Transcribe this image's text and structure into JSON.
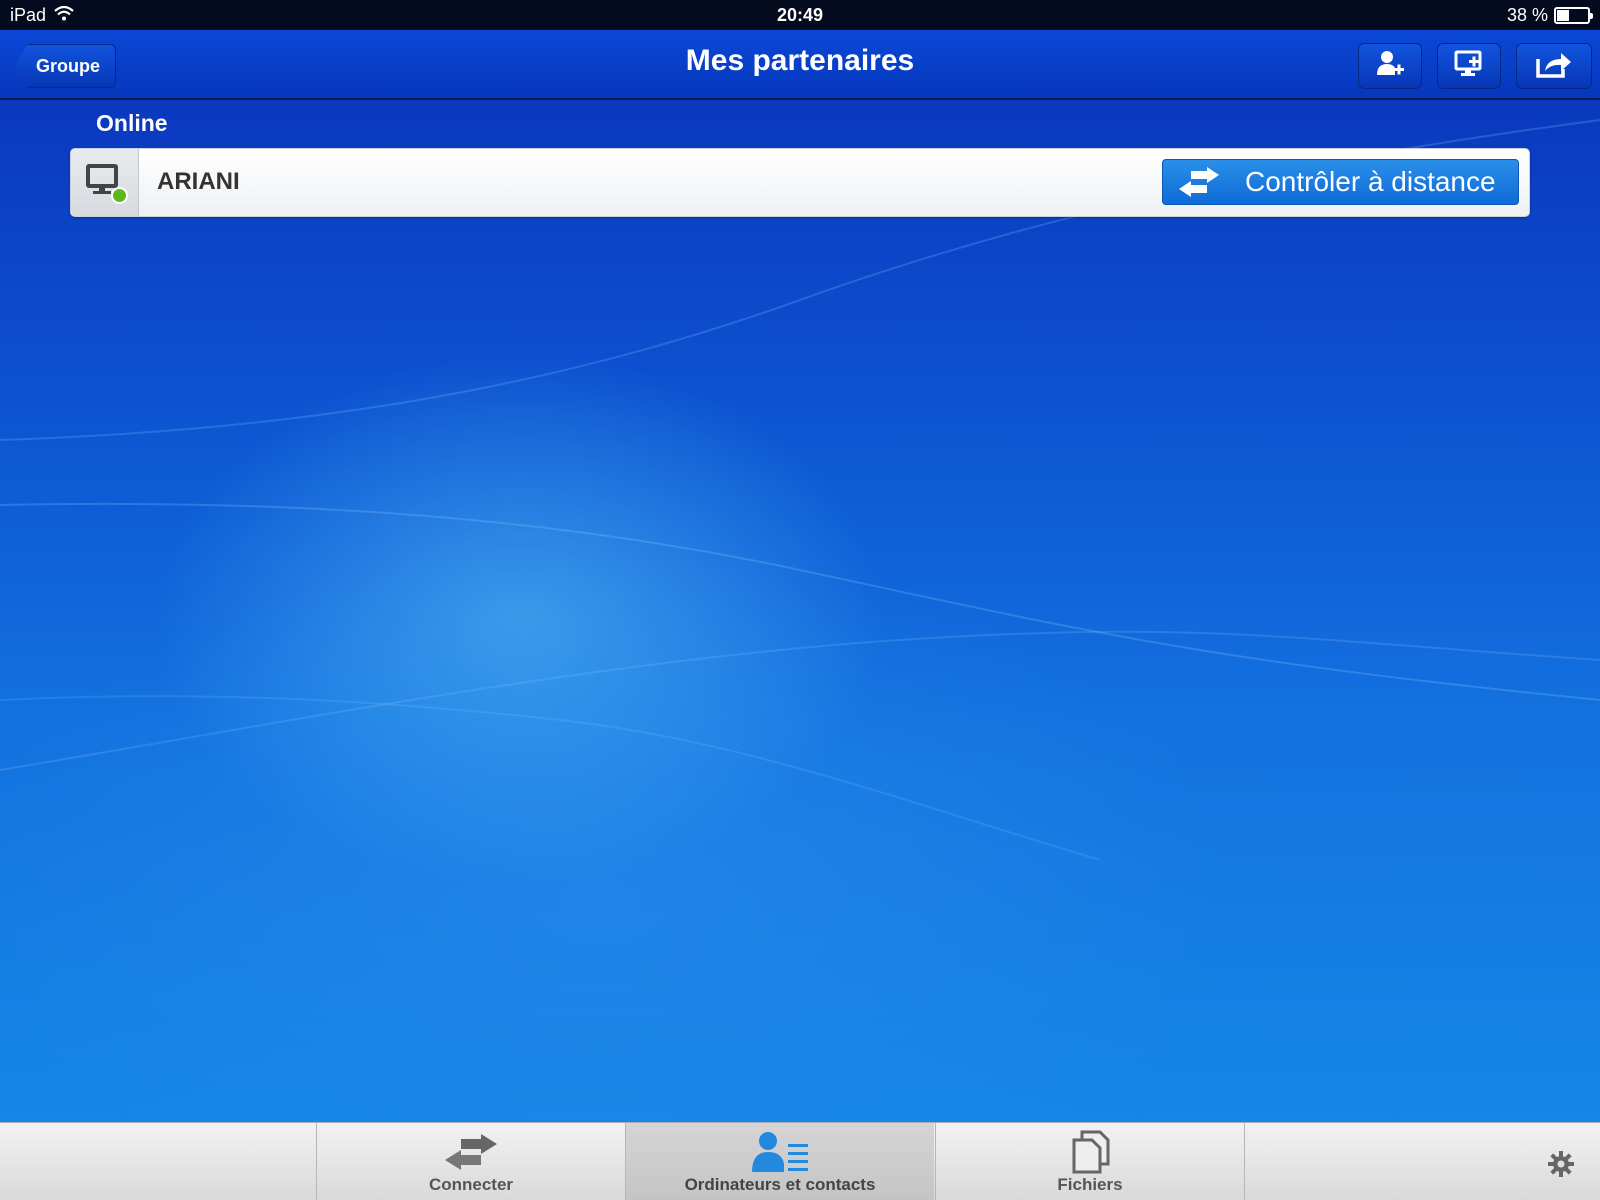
{
  "status_bar": {
    "device": "iPad",
    "time": "20:49",
    "battery": "38 %",
    "battery_level": 0.38
  },
  "nav": {
    "back_label": "Groupe",
    "title": "Mes partenaires",
    "actions": [
      "add-contact-icon",
      "add-computer-icon",
      "share-icon"
    ]
  },
  "section": {
    "title": "Online",
    "partners": [
      {
        "name": "ARIANI",
        "status": "online",
        "status_color": "#5fb81b",
        "action_label": "Contrôler à distance"
      }
    ]
  },
  "tabbar": {
    "tabs": [
      {
        "label": "Connecter",
        "icon": "arrows-icon",
        "active": false
      },
      {
        "label": "Ordinateurs et contacts",
        "icon": "contacts-icon",
        "active": true
      },
      {
        "label": "Fichiers",
        "icon": "files-icon",
        "active": false
      }
    ],
    "settings_icon": "gear-icon"
  },
  "colors": {
    "accent": "#0e6bd8",
    "nav": "#0637bd",
    "online": "#5fb81b"
  }
}
